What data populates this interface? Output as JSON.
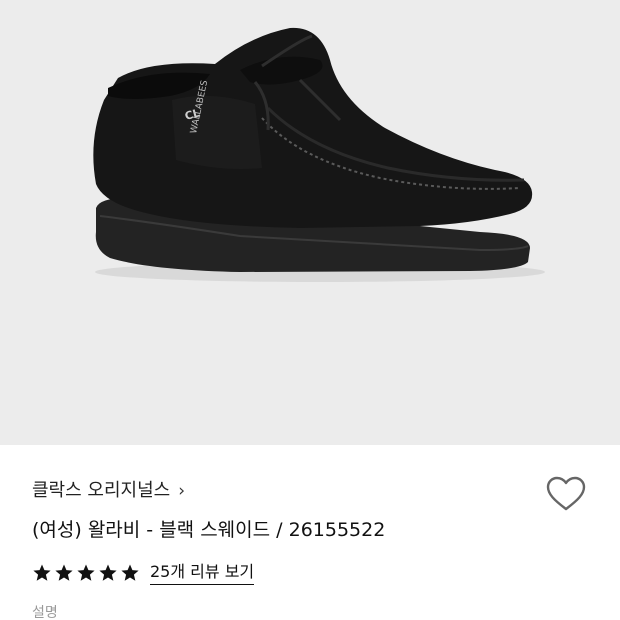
{
  "product": {
    "brand": "클락스 오리지널스",
    "brand_chevron": "›",
    "title": "(여성) 왈라비 - 블랙 스웨이드 / 26155522",
    "rating_stars": 5,
    "review_link": "25개 리뷰 보기",
    "description_label": "설명",
    "image": {
      "background": "#ececec",
      "shoe_color": "#161616",
      "sole_color": "#232323",
      "tag_text_top": "CL",
      "tag_text_side": "WALLABEES"
    }
  },
  "icons": {
    "wishlist": "heart-outline-icon",
    "star": "star-filled-icon",
    "chevron": "chevron-right-icon"
  },
  "colors": {
    "text_primary": "#111111",
    "text_muted": "#9a9a9a",
    "star": "#111111"
  }
}
